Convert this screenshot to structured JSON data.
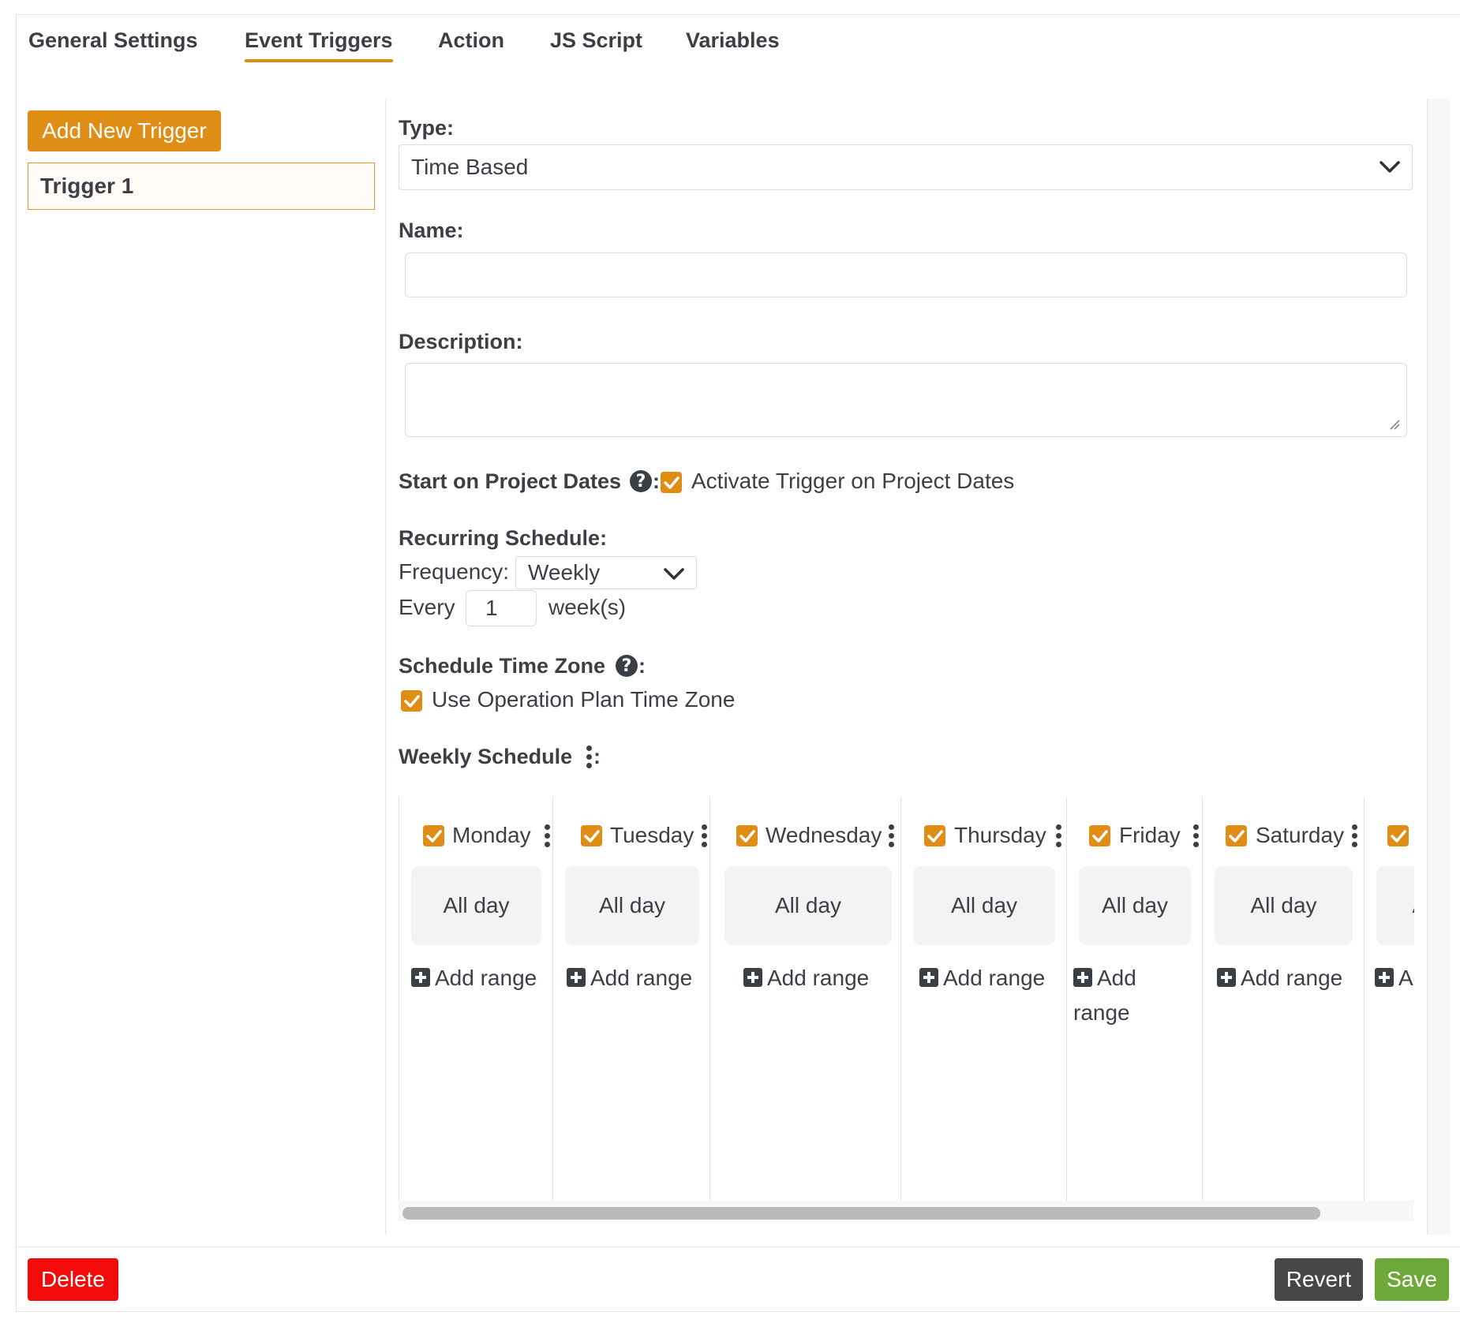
{
  "tabs": [
    {
      "label": "General Settings"
    },
    {
      "label": "Event Triggers",
      "active": true
    },
    {
      "label": "Action"
    },
    {
      "label": "JS Script"
    },
    {
      "label": "Variables"
    }
  ],
  "sidebar": {
    "add_button": "Add New Trigger",
    "triggers": [
      {
        "label": "Trigger 1",
        "selected": true
      }
    ]
  },
  "form": {
    "type_label": "Type:",
    "type_value": "Time Based",
    "name_label": "Name:",
    "name_value": "",
    "description_label": "Description:",
    "description_value": "",
    "start_on_project_dates_label": "Start on Project Dates",
    "colon": ":",
    "activate_trigger_label": "Activate Trigger on Project Dates",
    "activate_trigger_checked": true,
    "recurring_label": "Recurring Schedule:",
    "frequency_label": "Frequency:",
    "frequency_value": "Weekly",
    "every_label": "Every",
    "every_value": "1",
    "every_unit": "week(s)",
    "timezone_label": "Schedule Time Zone",
    "use_op_tz_label": "Use Operation Plan Time Zone",
    "use_op_tz_checked": true,
    "weekly_label": "Weekly Schedule"
  },
  "weekly": {
    "days": [
      {
        "name": "Monday",
        "checked": true,
        "allday": "All day",
        "add_range": "Add range"
      },
      {
        "name": "Tuesday",
        "checked": true,
        "allday": "All day",
        "add_range": "Add range"
      },
      {
        "name": "Wednesday",
        "checked": true,
        "allday": "All day",
        "add_range": "Add range"
      },
      {
        "name": "Thursday",
        "checked": true,
        "allday": "All day",
        "add_range": "Add range"
      },
      {
        "name": "Friday",
        "checked": true,
        "allday": "All day",
        "add_range": "Add range"
      },
      {
        "name": "Saturday",
        "checked": true,
        "allday": "All day",
        "add_range": "Add range"
      },
      {
        "name": "",
        "checked": true,
        "allday": "All day",
        "add_range": "Add range"
      }
    ]
  },
  "footer": {
    "delete": "Delete",
    "revert": "Revert",
    "save": "Save"
  },
  "colors": {
    "accent": "#e08d16",
    "delete": "#f30a0a",
    "revert": "#474747",
    "save": "#6fa83a"
  }
}
